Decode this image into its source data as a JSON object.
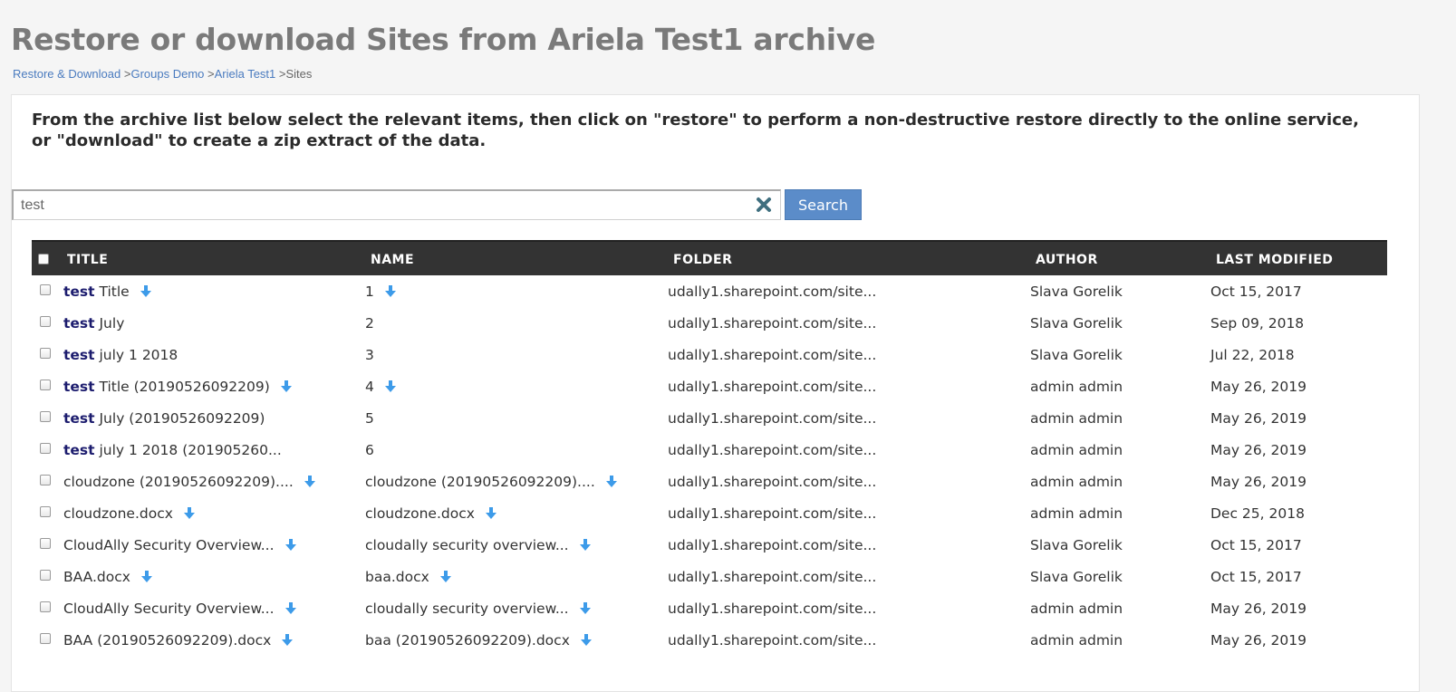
{
  "page": {
    "title": "Restore or download Sites from Ariela Test1 archive"
  },
  "breadcrumb": {
    "items": [
      {
        "label": "Restore & Download",
        "link": true
      },
      {
        "label": "Groups Demo",
        "link": true
      },
      {
        "label": "Ariela Test1",
        "link": true
      },
      {
        "label": "Sites",
        "link": false
      }
    ],
    "separator": ">"
  },
  "intro": {
    "text": "From the archive list below select the relevant items, then click on \"restore\" to perform a non-destructive restore directly to the online service, or \"download\" to create a zip extract of the data."
  },
  "search": {
    "value": "test",
    "button_label": "Search",
    "clear_icon": "close-x-icon"
  },
  "table": {
    "headers": {
      "title": "TITLE",
      "name": "NAME",
      "folder": "FOLDER",
      "author": "AUTHOR",
      "modified": "LAST MODIFIED"
    },
    "rows": [
      {
        "title_hl": "test",
        "title_rest": " Title",
        "title_dl": true,
        "name": "1",
        "name_dl": true,
        "folder": "udally1.sharepoint.com/site...",
        "author": "Slava Gorelik",
        "modified": "Oct 15, 2017"
      },
      {
        "title_hl": "test",
        "title_rest": " July",
        "title_dl": false,
        "name": "2",
        "name_dl": false,
        "folder": "udally1.sharepoint.com/site...",
        "author": "Slava Gorelik",
        "modified": "Sep 09, 2018"
      },
      {
        "title_hl": "test",
        "title_rest": " july 1 2018",
        "title_dl": false,
        "name": "3",
        "name_dl": false,
        "folder": "udally1.sharepoint.com/site...",
        "author": "Slava Gorelik",
        "modified": "Jul 22, 2018"
      },
      {
        "title_hl": "test",
        "title_rest": " Title (20190526092209)",
        "title_dl": true,
        "name": "4",
        "name_dl": true,
        "folder": "udally1.sharepoint.com/site...",
        "author": "admin admin",
        "modified": "May 26, 2019"
      },
      {
        "title_hl": "test",
        "title_rest": " July (20190526092209)",
        "title_dl": false,
        "name": "5",
        "name_dl": false,
        "folder": "udally1.sharepoint.com/site...",
        "author": "admin admin",
        "modified": "May 26, 2019"
      },
      {
        "title_hl": "test",
        "title_rest": " july 1 2018 (201905260...",
        "title_dl": false,
        "name": "6",
        "name_dl": false,
        "folder": "udally1.sharepoint.com/site...",
        "author": "admin admin",
        "modified": "May 26, 2019"
      },
      {
        "title_hl": "",
        "title_rest": "cloudzone (20190526092209)....",
        "title_dl": true,
        "name": "cloudzone (20190526092209)....",
        "name_dl": true,
        "folder": "udally1.sharepoint.com/site...",
        "author": "admin admin",
        "modified": "May 26, 2019"
      },
      {
        "title_hl": "",
        "title_rest": "cloudzone.docx",
        "title_dl": true,
        "name": "cloudzone.docx",
        "name_dl": true,
        "folder": "udally1.sharepoint.com/site...",
        "author": "admin admin",
        "modified": "Dec 25, 2018"
      },
      {
        "title_hl": "",
        "title_rest": "CloudAlly Security Overview...",
        "title_dl": true,
        "name": "cloudally security overview...",
        "name_dl": true,
        "folder": "udally1.sharepoint.com/site...",
        "author": "Slava Gorelik",
        "modified": "Oct 15, 2017"
      },
      {
        "title_hl": "",
        "title_rest": "BAA.docx",
        "title_dl": true,
        "name": "baa.docx",
        "name_dl": true,
        "folder": "udally1.sharepoint.com/site...",
        "author": "Slava Gorelik",
        "modified": "Oct 15, 2017"
      },
      {
        "title_hl": "",
        "title_rest": "CloudAlly Security Overview...",
        "title_dl": true,
        "name": "cloudally security overview...",
        "name_dl": true,
        "folder": "udally1.sharepoint.com/site...",
        "author": "admin admin",
        "modified": "May 26, 2019"
      },
      {
        "title_hl": "",
        "title_rest": "BAA (20190526092209).docx",
        "title_dl": true,
        "name": "baa (20190526092209).docx",
        "name_dl": true,
        "folder": "udally1.sharepoint.com/site...",
        "author": "admin admin",
        "modified": "May 26, 2019"
      }
    ]
  },
  "colors": {
    "header_bg": "#333333",
    "search_button": "#5b8cc9",
    "link": "#4a7bbf",
    "highlight": "#1c1c6e",
    "download_icon": "#3d9be9"
  },
  "icons": {
    "download": "download-arrow-icon",
    "clear": "close-x-icon"
  }
}
